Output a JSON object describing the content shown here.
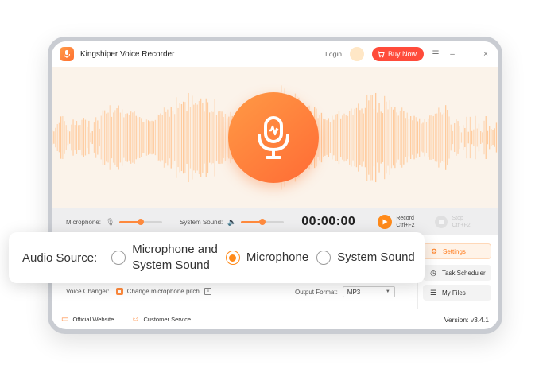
{
  "window": {
    "title": "Kingshiper Voice Recorder",
    "login_label": "Login",
    "buy_label": "Buy Now",
    "menu_icon": "menu-icon",
    "minimize_glyph": "–",
    "maximize_glyph": "□",
    "close_glyph": "×"
  },
  "controls": {
    "microphone_label": "Microphone:",
    "microphone_volume": 0.5,
    "system_sound_label": "System Sound:",
    "system_sound_volume": 0.5,
    "timer": "00:00:00",
    "record_label": "Record",
    "record_shortcut": "Ctrl+F2",
    "stop_label": "Stop",
    "stop_shortcut": "Ctrl+F2"
  },
  "side_panel": {
    "settings_label": "Settings",
    "scheduler_label": "Task Scheduler",
    "files_label": "My Files"
  },
  "options": {
    "voice_changer_label": "Voice Changer:",
    "pitch_label": "Change microphone pitch",
    "output_format_label": "Output Format:",
    "output_format_value": "MP3"
  },
  "footer": {
    "website_label": "Official Website",
    "service_label": "Customer Service",
    "version_label": "Version:",
    "version_value": "v3.4.1"
  },
  "audio_source": {
    "label": "Audio Source:",
    "options": [
      {
        "line1": "Microphone and",
        "line2": "System Sound",
        "selected": false
      },
      {
        "line1": "Microphone",
        "line2": "",
        "selected": true
      },
      {
        "line1": "System Sound",
        "line2": "",
        "selected": false
      }
    ]
  },
  "colors": {
    "accent": "#ff8a1a",
    "buy_button": "#ff4b3a",
    "hero_background": "#fbf3ea",
    "waveform": "#ffc99a"
  }
}
